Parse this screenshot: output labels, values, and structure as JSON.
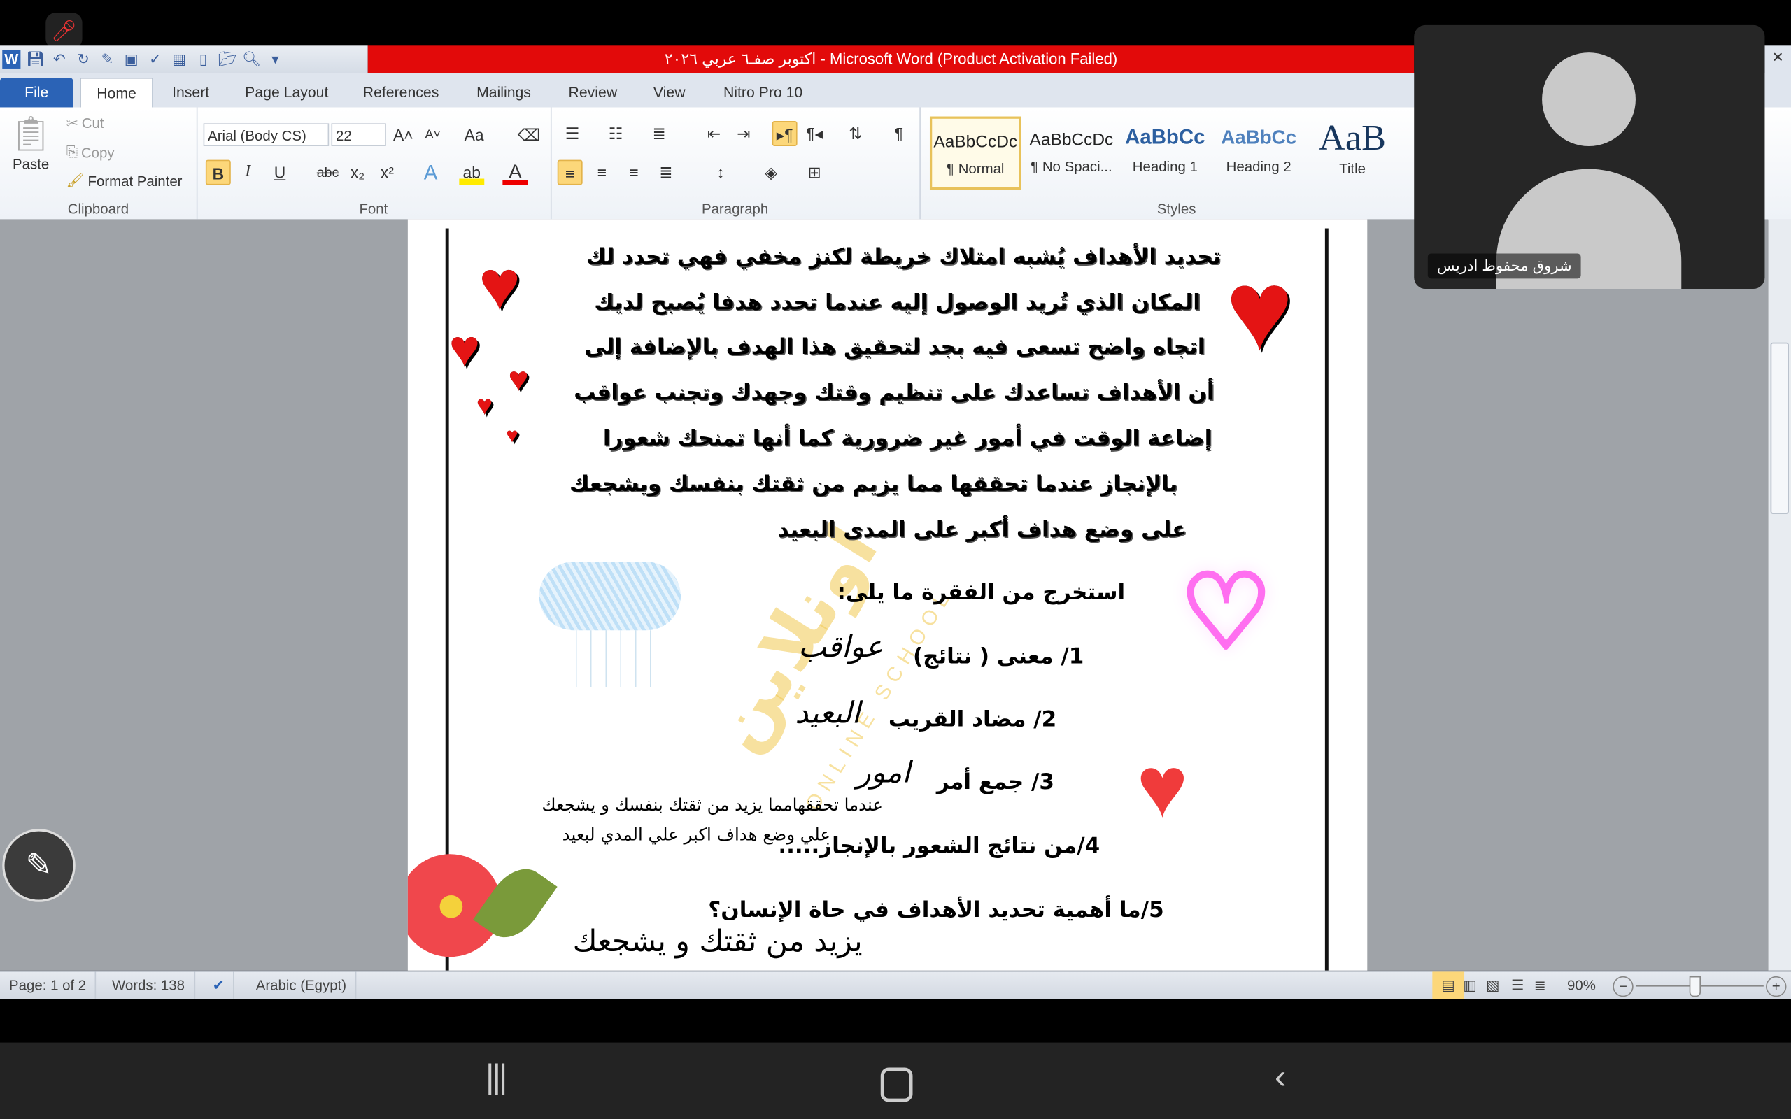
{
  "window": {
    "title": "اكتوبر صفـ٦ عربي ٢٠٢٦  - Microsoft Word (Product Activation Failed)",
    "close_glyph": "×",
    "help_glyph": "?"
  },
  "tabs": [
    {
      "label": "File"
    },
    {
      "label": "Home"
    },
    {
      "label": "Insert"
    },
    {
      "label": "Page Layout"
    },
    {
      "label": "References"
    },
    {
      "label": "Mailings"
    },
    {
      "label": "Review"
    },
    {
      "label": "View"
    },
    {
      "label": "Nitro Pro 10"
    }
  ],
  "ribbon": {
    "clipboard": {
      "label": "Clipboard",
      "paste": "Paste",
      "cut": "Cut",
      "copy": "Copy",
      "format_painter": "Format Painter"
    },
    "font": {
      "label": "Font",
      "font_name": "Arial (Body CS)",
      "font_size": "22"
    },
    "paragraph": {
      "label": "Paragraph"
    },
    "styles": {
      "label": "Styles",
      "items": [
        {
          "preview": "AaBbCcDc",
          "name": "¶ Normal"
        },
        {
          "preview": "AaBbCcDc",
          "name": "¶ No Spaci..."
        },
        {
          "preview": "AaBbCc",
          "name": "Heading 1"
        },
        {
          "preview": "AaBbCc",
          "name": "Heading 2"
        },
        {
          "preview": "AaB",
          "name": "Title"
        }
      ]
    }
  },
  "document": {
    "paragraph_lines": [
      "تحديد الأهداف يُشبه امتلاك خريطة لكنز مخفي  فهي تحدد لك",
      "المكان الذي تُريد الوصول إليه عندما تحدد هدفا يُصبح لديك",
      "اتجاه واضح تسعى فيه بجد لتحقيق هذا الهدف بالإضافة إلى",
      "أن الأهداف تساعدك على تنظيم وقتك وجهدك وتجنب عواقب",
      "إضاعة الوقت في أمور غير ضرورية كما أنها تمنحك شعورا",
      "بالإنجاز عندما تحققها مما يزيم من ثقتك بنفسك ويشجعك",
      "على وضع هداف أكبر على المدى البعيد"
    ],
    "instruction": "استخرج من الفقرة ما يلى:",
    "questions": [
      {
        "text": "1/ معنى ( نتائج)",
        "answer": "عواقب"
      },
      {
        "text": "2/ مضاد القريب",
        "answer": "البعيد"
      },
      {
        "text": "3/ جمع أمر",
        "answer": "امور"
      },
      {
        "text": "4/من نتائج الشعور بالإنجاز.....",
        "answer": ""
      },
      {
        "text": "5/ما أهمية تحديد الأهداف في حاة الإنسان؟",
        "answer": "يزيد من ثقتك و يشجعك"
      }
    ],
    "typed_answer_lines": [
      "عندما تحققهامما يزيد من ثقتك بنفسك و يشجعك",
      "علي وضع هداف اكبر علي المدي لبعيد"
    ],
    "watermark": {
      "arabic": "اونلاين",
      "latin": "ONLINE SCHOOL"
    }
  },
  "status": {
    "page": "Page: 1 of 2",
    "words": "Words: 138",
    "language": "Arabic (Egypt)",
    "zoom": "90%",
    "zoom_level_percent": 90
  },
  "video": {
    "participant_name": "شروق محفوظ ادريس"
  },
  "colors": {
    "title_bar": "#e20a0a",
    "file_tab": "#2b63b6",
    "heart": "#e41414"
  }
}
